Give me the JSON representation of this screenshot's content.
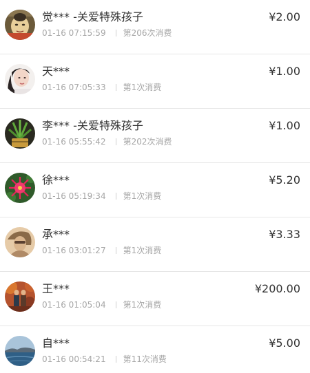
{
  "records": [
    {
      "name": "觉*** -关爱特殊孩子",
      "time": "01-16 07:15:59",
      "count": "第206次消费",
      "amount": "¥2.00",
      "avatar": "buddha-figure-avatar"
    },
    {
      "name": "天***",
      "time": "01-16 07:05:33",
      "count": "第1次消费",
      "amount": "¥1.00",
      "avatar": "woman-portrait-avatar"
    },
    {
      "name": "李*** -关爱特殊孩子",
      "time": "01-16 05:55:42",
      "count": "第202次消费",
      "amount": "¥1.00",
      "avatar": "potted-plant-avatar"
    },
    {
      "name": "徐***",
      "time": "01-16 05:19:34",
      "count": "第1次消费",
      "amount": "¥5.20",
      "avatar": "red-flower-avatar"
    },
    {
      "name": "承***",
      "time": "01-16 03:01:27",
      "count": "第1次消费",
      "amount": "¥3.33",
      "avatar": "sepia-portrait-avatar"
    },
    {
      "name": "王***",
      "time": "01-16 01:05:04",
      "count": "第1次消费",
      "amount": "¥200.00",
      "avatar": "autumn-couple-avatar"
    },
    {
      "name": "自***",
      "time": "01-16 00:54:21",
      "count": "第11次消费",
      "amount": "¥5.00",
      "avatar": "seascape-avatar"
    }
  ]
}
